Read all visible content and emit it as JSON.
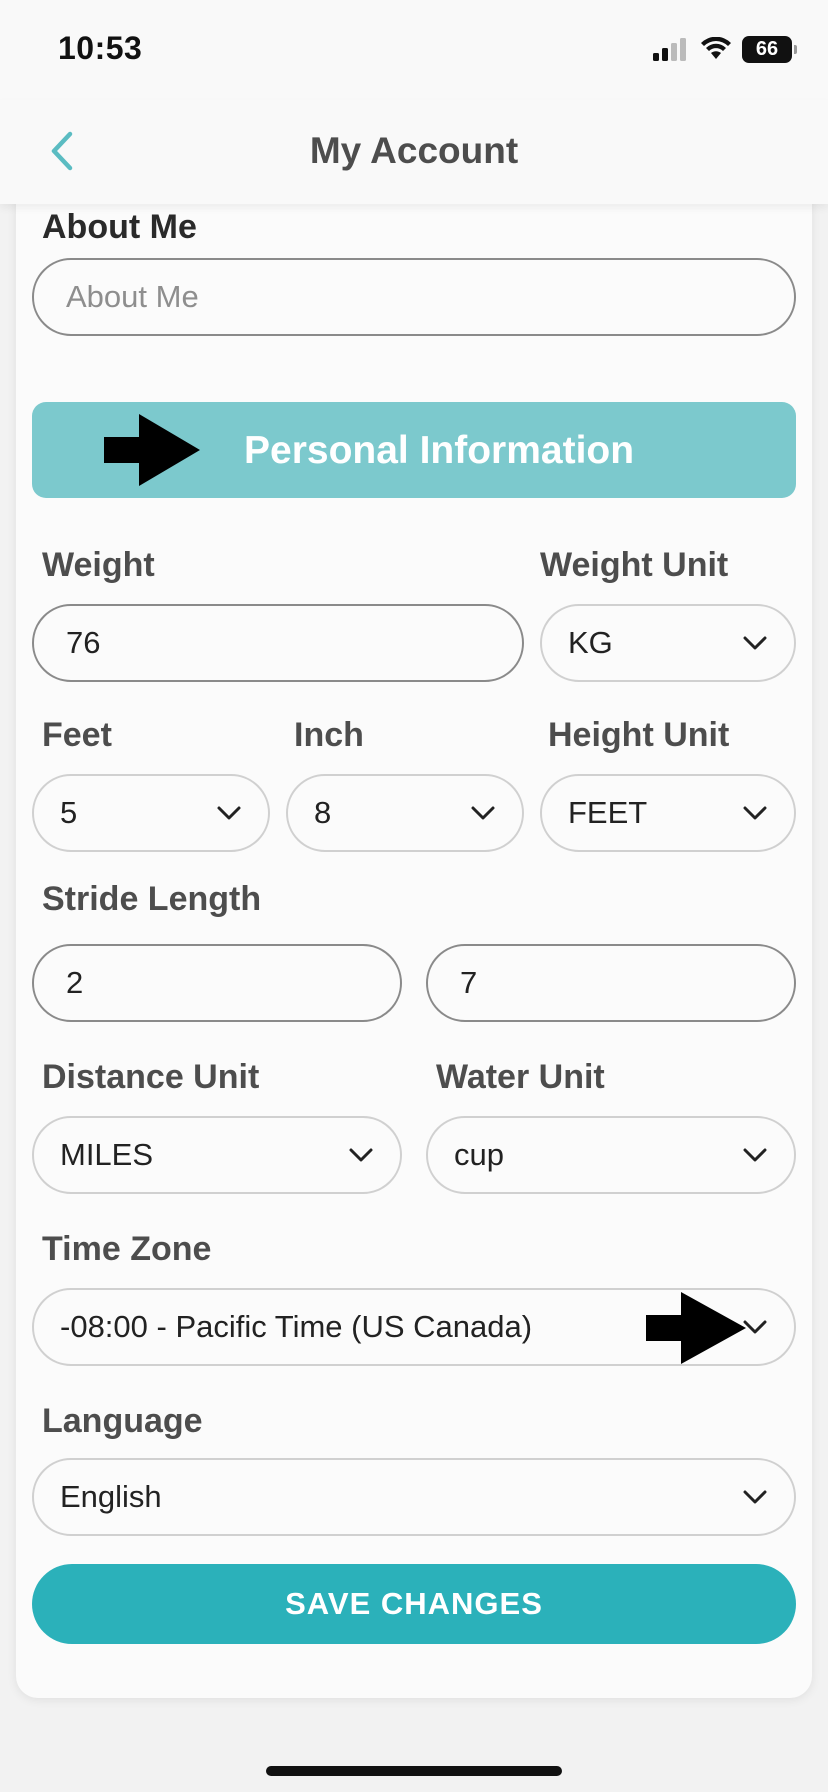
{
  "status": {
    "time": "10:53",
    "battery": "66",
    "icons": [
      "signal-icon",
      "wifi-icon",
      "battery-icon"
    ]
  },
  "header": {
    "title": "My Account",
    "back_icon": "chevron-left-icon"
  },
  "about": {
    "label": "About Me",
    "placeholder": "About Me"
  },
  "section": {
    "title": "Personal Information"
  },
  "weight": {
    "label": "Weight",
    "value": "76",
    "unit_label": "Weight Unit",
    "unit_value": "KG"
  },
  "height": {
    "feet_label": "Feet",
    "feet_value": "5",
    "inch_label": "Inch",
    "inch_value": "8",
    "unit_label": "Height Unit",
    "unit_value": "FEET"
  },
  "stride": {
    "label": "Stride Length",
    "value_1": "2",
    "value_2": "7"
  },
  "distance": {
    "label": "Distance Unit",
    "value": "MILES"
  },
  "water": {
    "label": "Water Unit",
    "value": "cup"
  },
  "timezone": {
    "label": "Time Zone",
    "value": "-08:00 - Pacific Time (US Canada)"
  },
  "language": {
    "label": "Language",
    "value": "English"
  },
  "actions": {
    "save_label": "SAVE CHANGES"
  },
  "colors": {
    "accent": "#2bb1ba",
    "banner": "#7cc9cd",
    "back_icon": "#5bbcc2"
  }
}
